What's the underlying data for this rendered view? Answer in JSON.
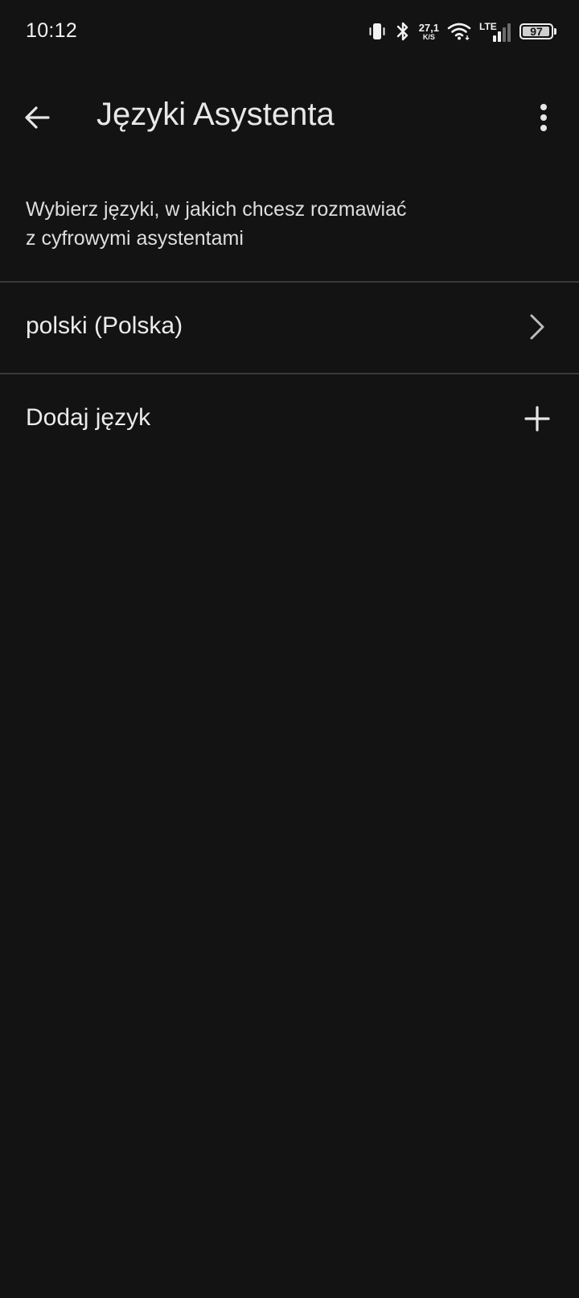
{
  "status_bar": {
    "time": "10:12",
    "net_speed_value": "27,1",
    "net_speed_unit": "K/S",
    "network_type": "LTE",
    "battery_level": "97",
    "battery_fraction": 0.97,
    "icons": [
      "vibrate-icon",
      "bluetooth-icon",
      "wifi-icon",
      "cellular-signal-icon",
      "battery-icon"
    ]
  },
  "app_bar": {
    "title": "Języki Asystenta",
    "back_icon": "arrow-back-icon",
    "more_icon": "more-vert-icon"
  },
  "description": {
    "line1": "Wybierz języki, w jakich chcesz rozmawiać",
    "line2": "z cyfrowymi asystentami"
  },
  "list": {
    "items": [
      {
        "label": "polski (Polska)",
        "icon": "chevron-right-icon"
      },
      {
        "label": "Dodaj język",
        "icon": "add-icon"
      }
    ]
  },
  "colors": {
    "background": "#131313",
    "text": "#e6e6e6",
    "divider": "#3a3a3a"
  }
}
